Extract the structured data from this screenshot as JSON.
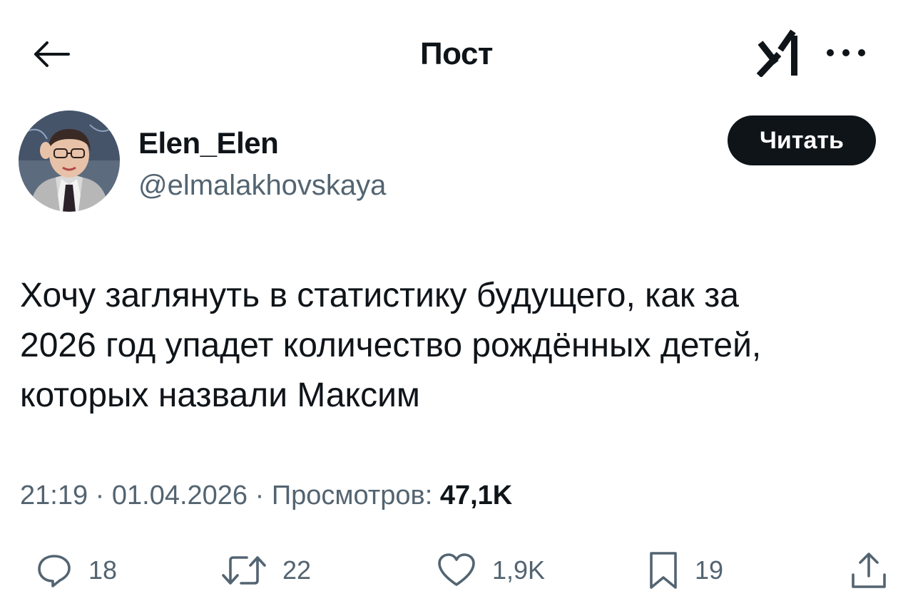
{
  "header": {
    "title": "Пост",
    "back_icon": "arrow-left-icon",
    "logo_icon": "grok-logo-icon",
    "more_icon": "more-horizontal-icon"
  },
  "author": {
    "display_name": "Elen_Elen",
    "handle": "@elmalakhovskaya",
    "follow_label": "Читать"
  },
  "post": {
    "lines": [
      "Хочу заглянуть в статистику будущего, как за",
      "2026 год упадет количество рождённых детей,",
      "которых назвали Максим"
    ]
  },
  "meta": {
    "time": "21:19",
    "separator": " · ",
    "date": "01.04.2026",
    "views_label": "Просмотров:",
    "views_count": "47,1K"
  },
  "actions": {
    "reply_count": "18",
    "repost_count": "22",
    "like_count": "1,9K",
    "bookmark_count": "19"
  },
  "colors": {
    "text_primary": "#0f1419",
    "text_secondary": "#536471",
    "button_bg": "#0f1419",
    "background": "#ffffff"
  }
}
